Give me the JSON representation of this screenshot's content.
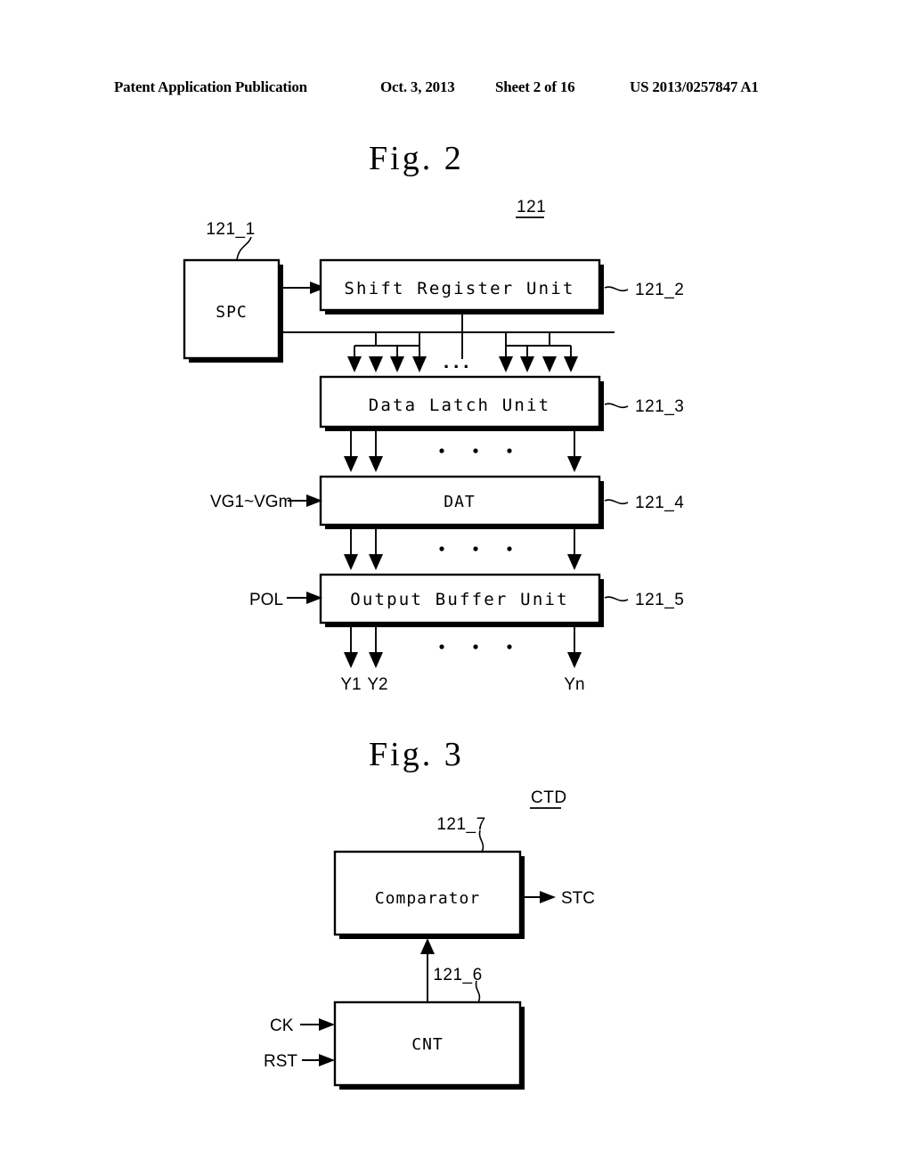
{
  "header": {
    "publication": "Patent Application Publication",
    "date": "Oct. 3, 2013",
    "sheet": "Sheet 2 of 16",
    "patent_number": "US 2013/0257847 A1"
  },
  "figures": [
    {
      "title": "Fig. 2",
      "top_reference": "121",
      "blocks": [
        {
          "label": "SPC",
          "ref": "121_1"
        },
        {
          "label": "Shift Register Unit",
          "ref": "121_2"
        },
        {
          "label": "Data Latch Unit",
          "ref": "121_3"
        },
        {
          "label": "DAT",
          "ref": "121_4"
        },
        {
          "label": "Output Buffer Unit",
          "ref": "121_5"
        }
      ],
      "inputs": [
        {
          "label": "VG1~VGm",
          "target": "DAT"
        },
        {
          "label": "POL",
          "target": "Output Buffer Unit"
        }
      ],
      "outputs": [
        {
          "label": "Y1"
        },
        {
          "label": "Y2"
        },
        {
          "label": "Yn"
        }
      ],
      "ellipsis": "..."
    },
    {
      "title": "Fig. 3",
      "top_reference": "CTD",
      "blocks": [
        {
          "label": "Comparator",
          "ref": "121_7"
        },
        {
          "label": "CNT",
          "ref": "121_6"
        }
      ],
      "inputs": [
        {
          "label": "CK",
          "target": "CNT"
        },
        {
          "label": "RST",
          "target": "CNT"
        }
      ],
      "outputs": [
        {
          "label": "STC"
        }
      ]
    }
  ]
}
